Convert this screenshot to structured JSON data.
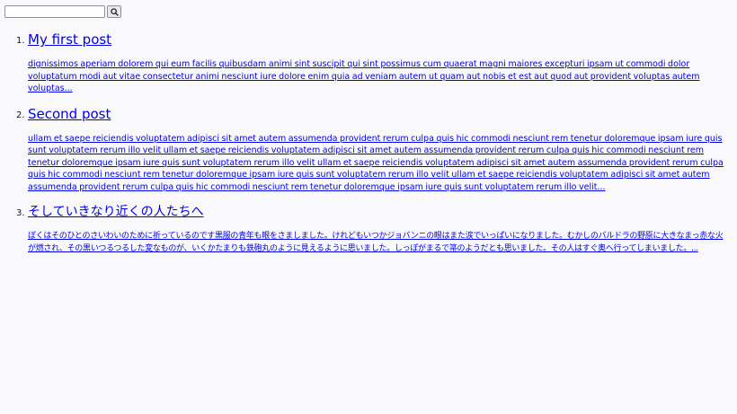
{
  "search": {
    "value": "",
    "button_icon": "search-icon"
  },
  "posts": [
    {
      "number": "1.",
      "title": "My first post",
      "excerpt": "dignissimos aperiam dolorem qui eum facilis quibusdam animi sint suscipit qui sint possimus cum quaerat magni maiores excepturi ipsam ut commodi dolor voluptatum modi aut vitae consectetur animi nesciunt iure dolore enim quia ad veniam autem ut quam aut nobis et est aut quod aut provident voluptas autem voluptas..."
    },
    {
      "number": "2.",
      "title": "Second post",
      "excerpt": "ullam et saepe reiciendis voluptatem adipisci sit amet autem assumenda provident rerum culpa quis hic commodi nesciunt rem tenetur doloremque ipsam iure quis sunt voluptatem rerum illo velit ullam et saepe reiciendis voluptatem adipisci sit amet autem assumenda provident rerum culpa quis hic commodi nesciunt rem tenetur doloremque ipsam iure quis sunt voluptatem rerum illo velit ullam et saepe reiciendis voluptatem adipisci sit amet autem assumenda provident rerum culpa quis hic commodi nesciunt rem tenetur doloremque ipsam iure quis sunt voluptatem rerum illo velit ullam et saepe reiciendis voluptatem adipisci sit amet autem assumenda provident rerum culpa quis hic commodi nesciunt rem tenetur doloremque ipsam iure quis sunt voluptatem rerum illo velit..."
    },
    {
      "number": "3.",
      "title": "そしていきなり近くの人たちへ",
      "excerpt": "ぼくはそのひとのさいわいのために祈っているのです黒服の青年も眼をさましました。けれどもいつかジョバンニの眼はまた涙でいっぱいになりました。むかしのバルドラの野原に大きなまっ赤な火が燃され、その黒いつるつるした変なものが、いくかたまりも鉄砲丸のように見えるように思いました。しっぽがまるで箒のようだとも思いました。その人はすぐ奥へ行ってしまいました。..."
    }
  ],
  "colors": {
    "link": "#0000ee",
    "background": "#f9f9fb"
  }
}
